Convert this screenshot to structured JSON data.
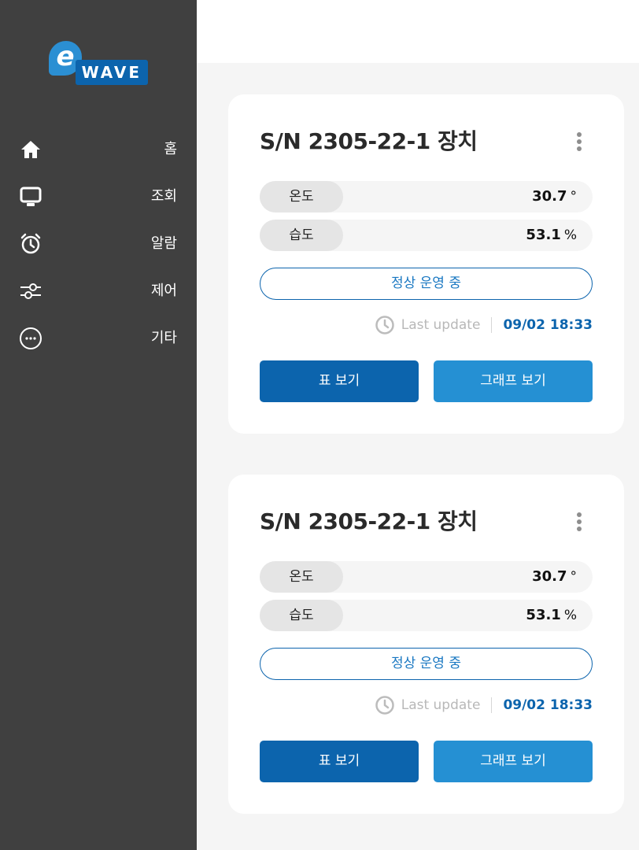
{
  "app": {
    "logo_letter": "e",
    "logo_wave": "WAVE"
  },
  "sidebar": {
    "items": [
      {
        "label": "홈",
        "icon": "home-icon"
      },
      {
        "label": "조회",
        "icon": "monitor-icon"
      },
      {
        "label": "알람",
        "icon": "alarm-clock-icon"
      },
      {
        "label": "제어",
        "icon": "sliders-icon"
      },
      {
        "label": "기타",
        "icon": "more-circle-icon"
      }
    ]
  },
  "devices": [
    {
      "title": "S/N 2305-22-1 장치",
      "temperature": {
        "label": "온도",
        "value": "30.7",
        "unit": "°"
      },
      "humidity": {
        "label": "습도",
        "value": "53.1",
        "unit": "%"
      },
      "status": "정상 운영 중",
      "update_label": "Last update",
      "update_time": "09/02 18:33",
      "table_button": "표 보기",
      "graph_button": "그래프 보기"
    },
    {
      "title": "S/N 2305-22-1 장치",
      "temperature": {
        "label": "온도",
        "value": "30.7",
        "unit": "°"
      },
      "humidity": {
        "label": "습도",
        "value": "53.1",
        "unit": "%"
      },
      "status": "정상 운영 중",
      "update_label": "Last update",
      "update_time": "09/02 18:33",
      "table_button": "표 보기",
      "graph_button": "그래프 보기"
    }
  ],
  "colors": {
    "sidebar_bg": "#404040",
    "primary": "#0c64ad",
    "accent": "#2590d3",
    "page_bg": "#f5f5f5"
  }
}
